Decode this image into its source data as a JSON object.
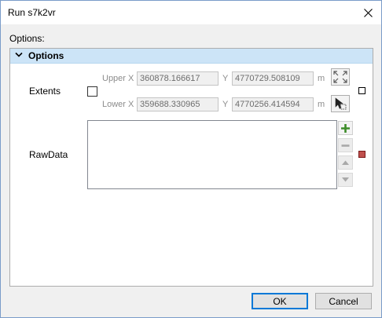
{
  "window": {
    "title": "Run s7k2vr"
  },
  "options_label": "Options:",
  "group": {
    "title": "Options"
  },
  "extents": {
    "label": "Extents",
    "upper_x_label": "Upper X",
    "upper_x_value": "360878.166617",
    "upper_y_label": "Y",
    "upper_y_value": "4770729.508109",
    "upper_unit": "m",
    "lower_x_label": "Lower X",
    "lower_x_value": "359688.330965",
    "lower_y_label": "Y",
    "lower_y_value": "4770256.414594",
    "lower_unit": "m",
    "checked": false
  },
  "rawdata": {
    "label": "RawData",
    "items": []
  },
  "footer": {
    "ok": "OK",
    "cancel": "Cancel"
  },
  "colors": {
    "header_bg": "#cce4f7",
    "add_green": "#3c8c28",
    "required_red": "#c0504d",
    "primary_border": "#0078d7"
  },
  "icons": {
    "close": "close-icon",
    "expand": "chevron-down-icon",
    "zoom_extents": "full-extent-icon",
    "select_extent": "select-arrow-icon",
    "add": "plus-icon",
    "remove": "minus-icon",
    "up": "arrow-up-icon",
    "down": "arrow-down-icon"
  }
}
